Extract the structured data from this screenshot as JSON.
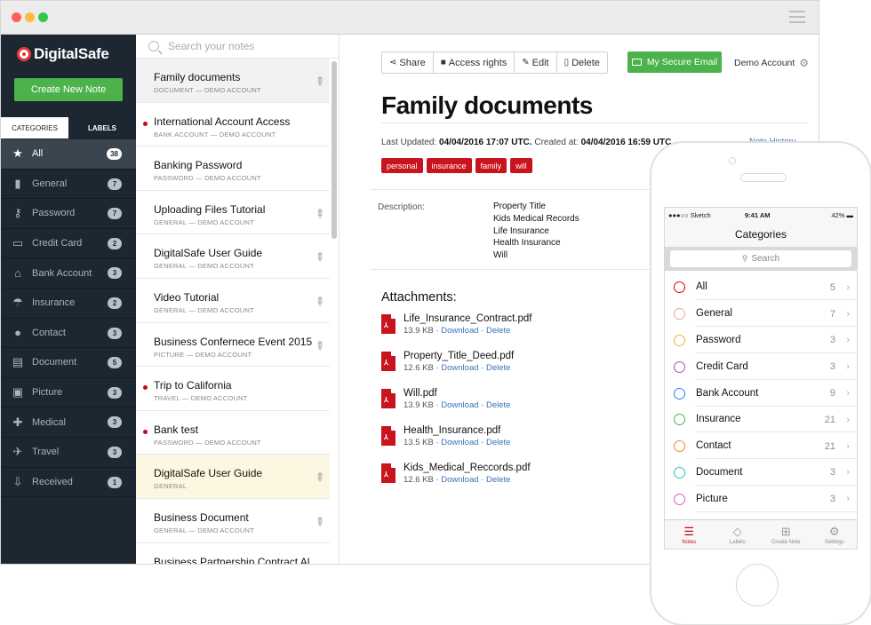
{
  "colors": {
    "accent_green": "#4cb34c",
    "tag_red": "#c9141e",
    "sidebar_bg": "#1d2732",
    "link_blue": "#3b73b9",
    "unread_dot": "#d0021b"
  },
  "app": {
    "logo_text": "DigitalSafe",
    "new_note_label": "Create New Note"
  },
  "sidebar": {
    "tabs": [
      "CATEGORIES",
      "LABELS"
    ],
    "categories": [
      {
        "label": "All",
        "count": "38",
        "icon": "star-icon"
      },
      {
        "label": "General",
        "count": "7",
        "icon": "book-icon"
      },
      {
        "label": "Password",
        "count": "7",
        "icon": "key-icon"
      },
      {
        "label": "Credit Card",
        "count": "2",
        "icon": "credit-card-icon"
      },
      {
        "label": "Bank Account",
        "count": "3",
        "icon": "bank-icon"
      },
      {
        "label": "Insurance",
        "count": "2",
        "icon": "umbrella-icon"
      },
      {
        "label": "Contact",
        "count": "3",
        "icon": "person-icon"
      },
      {
        "label": "Document",
        "count": "5",
        "icon": "briefcase-icon"
      },
      {
        "label": "Picture",
        "count": "3",
        "icon": "picture-icon"
      },
      {
        "label": "Medical",
        "count": "3",
        "icon": "medical-kit-icon"
      },
      {
        "label": "Travel",
        "count": "3",
        "icon": "airplane-icon"
      },
      {
        "label": "Received",
        "count": "1",
        "icon": "inbox-icon"
      }
    ]
  },
  "notes": {
    "search_placeholder": "Search your notes",
    "items": [
      {
        "title": "Family documents",
        "sub": "DOCUMENT — DEMO ACCOUNT"
      },
      {
        "title": "International Account Access",
        "sub": "BANK ACCOUNT — DEMO ACCOUNT"
      },
      {
        "title": "Banking Password",
        "sub": "PASSWORD — DEMO ACCOUNT"
      },
      {
        "title": "Uploading Files Tutorial",
        "sub": "GENERAL — DEMO ACCOUNT"
      },
      {
        "title": "DigitalSafe User Guide",
        "sub": "GENERAL — DEMO ACCOUNT"
      },
      {
        "title": "Video Tutorial",
        "sub": "GENERAL — DEMO ACCOUNT"
      },
      {
        "title": "Business Confernece Event 2015",
        "sub": "PICTURE — DEMO ACCOUNT"
      },
      {
        "title": "Trip to California",
        "sub": "TRAVEL — DEMO ACCOUNT"
      },
      {
        "title": "Bank test",
        "sub": "PASSWORD — DEMO ACCOUNT"
      },
      {
        "title": "DigitalSafe User Guide",
        "sub": "GENERAL"
      },
      {
        "title": "Business Document",
        "sub": "GENERAL — DEMO ACCOUNT"
      },
      {
        "title": "Business Partnership Contract Al",
        "sub": ""
      }
    ]
  },
  "toolbar": {
    "share": "Share",
    "access": "Access rights",
    "edit": "Edit",
    "delete": "Delete",
    "secure_email": "My Secure Email",
    "account": "Demo Account"
  },
  "document": {
    "title": "Family documents",
    "updated_label": "Last Updated: ",
    "updated_value": "04/04/2016 17:07 UTC.",
    "created_label": " Created at: ",
    "created_value": "04/04/2016 16:59 UTC",
    "history_link": "Note History",
    "tags": [
      "personal",
      "insurance",
      "family",
      "will"
    ],
    "description_label": "Description:",
    "description_lines": [
      "Property Title",
      "Kids Medical Records",
      "Life Insurance",
      "Health Insurance",
      "Will"
    ],
    "attachments_title": "Attachments:",
    "download_label": "Download",
    "delete_label": "Delete",
    "attachments": [
      {
        "name": "Life_Insurance_Contract.pdf",
        "size": "13.9 KB"
      },
      {
        "name": "Property_Title_Deed.pdf",
        "size": "12.6 KB"
      },
      {
        "name": "Will.pdf",
        "size": "13.9 KB"
      },
      {
        "name": "Health_Insurance.pdf",
        "size": "13.5 KB"
      },
      {
        "name": "Kids_Medical_Reccords.pdf",
        "size": "12.6 KB"
      }
    ]
  },
  "phone": {
    "status_left": "●●●○○ Sketch",
    "time": "9:41 AM",
    "battery": "42%",
    "nav_title": "Categories",
    "search_placeholder": "Search",
    "rows": [
      {
        "label": "All",
        "count": "5"
      },
      {
        "label": "General",
        "count": "7"
      },
      {
        "label": "Password",
        "count": "3"
      },
      {
        "label": "Credit Card",
        "count": "3"
      },
      {
        "label": "Bank Account",
        "count": "9"
      },
      {
        "label": "Insurance",
        "count": "21"
      },
      {
        "label": "Contact",
        "count": "21"
      },
      {
        "label": "Document",
        "count": "3"
      },
      {
        "label": "Picture",
        "count": "3"
      }
    ],
    "tabs": [
      "Notes",
      "Labels",
      "Create Note",
      "Settings"
    ]
  }
}
